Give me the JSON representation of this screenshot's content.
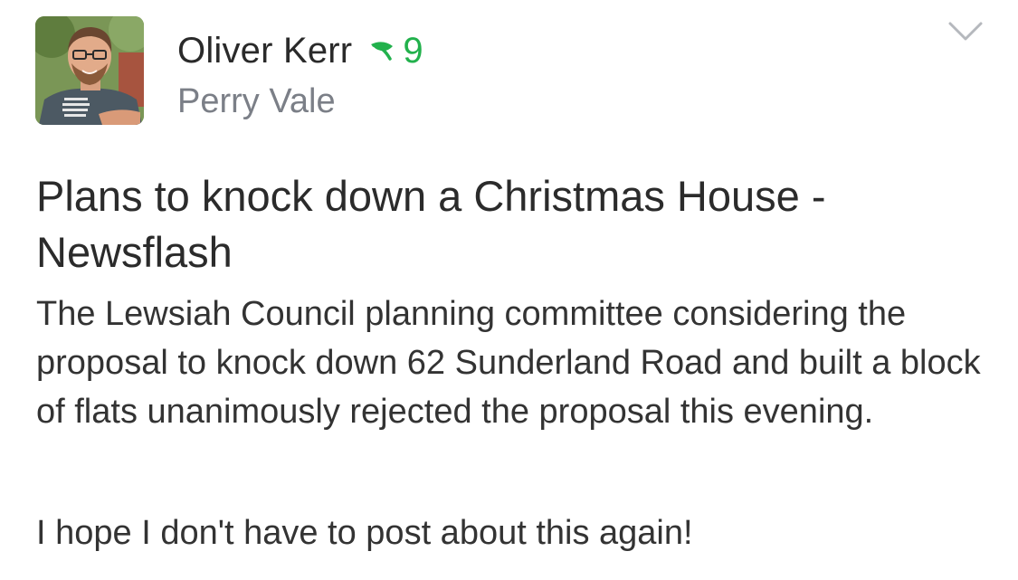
{
  "post": {
    "author": {
      "name": "Oliver Kerr",
      "karma": "9",
      "neighbourhood": "Perry Vale",
      "badge_icon": "leaf-icon",
      "avatar": "author-avatar-photo"
    },
    "menu_icon": "chevron-down-icon",
    "title": "Plans to knock down a Christmas House - Newsflash",
    "paragraphs": [
      "The Lewsiah Council planning committee considering the proposal to knock down 62 Sunderland Road and built a block of flats unanimously rejected the proposal this evening.",
      "I hope I don't have to post about this again!"
    ]
  },
  "colors": {
    "karma_green": "#22b14c",
    "secondary_gray": "#7b7f87",
    "text_dark": "#333333",
    "chevron_gray": "#b5b8bd"
  }
}
